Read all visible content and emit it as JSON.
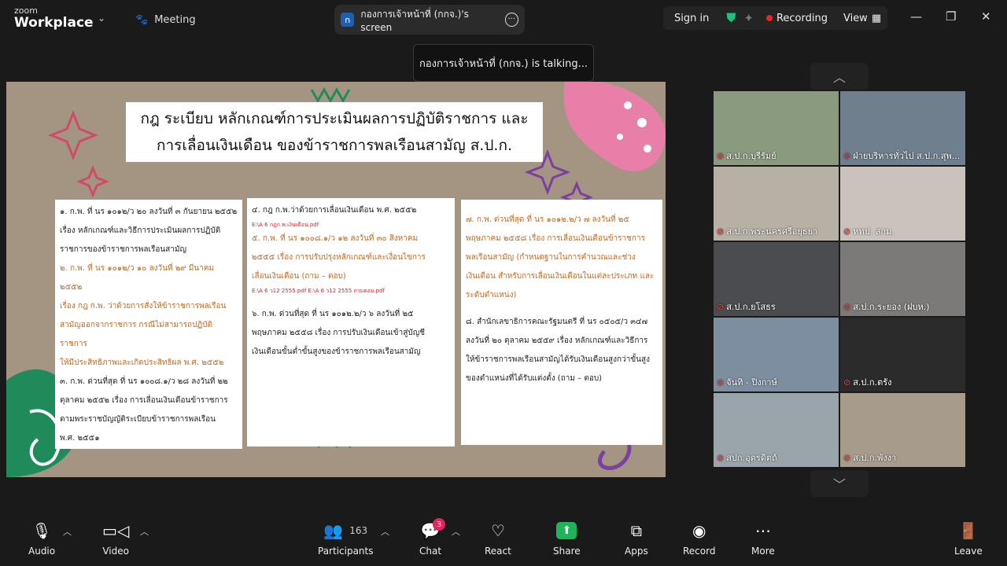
{
  "app": {
    "small": "zoom",
    "name": "Workplace",
    "meeting_tab": "Meeting",
    "screen_tab": "กองการเจ้าหน้าที่ (กกจ.)'s screen",
    "screen_badge": "n"
  },
  "header": {
    "sign_in": "Sign in",
    "recording": "Recording",
    "view": "View"
  },
  "talking": "กองการเจ้าหน้าที่ (กกจ.) is talking...",
  "slide": {
    "title_1": "กฎ ระเบียบ หลักเกณฑ์การประเมินผลการปฏิบัติราชการ และ",
    "title_2": "การเลื่อนเงินเดือน ของข้าราชการพลเรือนสามัญ ส.ป.ก.",
    "col1": [
      "๑. ก.พ. ที่ นร ๑๐๑๒/ว ๒๐ ลงวันที่ ๓ กันยายน ๒๕๕๒",
      "เรื่อง หลักเกณฑ์และวิธีการประเมินผลการปฏิบัติ",
      "ราชการของข้าราชการพลเรือนสามัญ",
      "๒. ก.พ. ที่ นร ๑๐๑๒/ว ๑๐ ลงวันที่ ๒๙ มีนาคม ๒๕๕๒",
      "เรื่อง กฎ ก.พ. ว่าด้วยการสั่งให้ข้าราชการพลเรือน",
      "สามัญออกจากราชการ กรณีไม่สามารถปฏิบัติราชการ",
      "ให้มีประสิทธิภาพและเกิดประสิทธิผล พ.ศ. ๒๕๕๒",
      "๓. ก.พ. ด่วนที่สุด ที่ นร ๑๐๐๘.๑/ว ๒๘ ลงวันที่ ๒๒",
      "ตุลาคม ๒๕๕๒ เรื่อง การเลื่อนเงินเดือนข้าราชการ",
      "ตามพระราชบัญญัติระเบียบข้าราชการพลเรือน",
      "พ.ศ. ๒๕๕๑"
    ],
    "col2": [
      "๔. กฎ ก.พ.ว่าด้วยการเลื่อนเงินเดือน พ.ศ. ๒๕๕๒",
      "E:\\A 6 กฎก.พ.เงินเดือน.pdf",
      "๕. ก.พ. ที่ นร ๑๐๐๘.๑/ว ๑๒ ลงวันที่ ๓๐ สิงหาคม",
      "๒๕๕๕ เรื่อง การปรับปรุงหลักเกณฑ์และเงื่อนไขการ",
      "เลื่อนเงินเดือน (ถาม – ตอบ)",
      "E:\\A 6 ว12 2555.pdf   E:\\A 6 ว12 2555 ถามตอบ.pdf",
      "๖. ก.พ. ด่วนที่สุด ที่ นร ๑๐๑๒.๒/ว ๖ ลงวันที่ ๒๕",
      "พฤษภาคม ๒๕๕๘ เรื่อง การปรับเงินเดือนเข้าสู่บัญชี",
      "เงินเดือนขั้นต่ำขั้นสูงของข้าราชการพลเรือนสามัญ"
    ],
    "col3": [
      "๗. ก.พ. ด่วนที่สุด ที่ นร ๑๐๑๒.๒/ว ๗ ลงวันที่ ๒๕",
      "พฤษภาคม ๒๕๕๘ เรื่อง การเลื่อนเงินเดือนข้าราชการ",
      "พลเรือนสามัญ (กำหนดฐานในการคำนวณและช่วง",
      "เงินเดือน สำหรับการเลื่อนเงินเดือนในแต่ละประเภท และ",
      "ระดับตำแหน่ง)",
      "๘. สำนักเลขาธิการคณะรัฐมนตรี ที่ นร ๐๕๐๕/ว ๓๔๗",
      "ลงวันที่ ๒๐ ตุลาคม ๒๕๕๙ เรื่อง หลักเกณฑ์และวิธีการ",
      "ให้ข้าราชการพลเรือนสามัญได้รับเงินเดือนสูงกว่าขั้นสูง",
      "ของตำแหน่งที่ได้รับแต่งตั้ง (ถาม – ตอบ)"
    ]
  },
  "participants_tiles": [
    {
      "name": "ส.ป.ก.บุรีรัมย์",
      "bg": "#8a9a7e"
    },
    {
      "name": "ฝ่ายบริหารทั่วไป ส.ป.ก.สุพ...",
      "bg": "#6f7f8e"
    },
    {
      "name": "ส.ป.ก.พระนครศรีอยุธยา",
      "bg": "#b7b0a4"
    },
    {
      "name": "หทป. สกม.",
      "bg": "#c9c3bb"
    },
    {
      "name": "ส.ป.ก.ยโสธร",
      "bg": "#4a4c4f"
    },
    {
      "name": "ส.ป.ก.ระยอง (ฝบห.)",
      "bg": "#7c7a78"
    },
    {
      "name": "จันทิ - ปิงกาษ์",
      "bg": "#7d8ea0"
    },
    {
      "name": "ส.ป.ก.ตรัง",
      "bg": "#2b2b2b"
    },
    {
      "name": "สปก.อุตรดิตถ์",
      "bg": "#9aa5ab"
    },
    {
      "name": "ส.ป.ก.พังงา",
      "bg": "#a79c8c"
    }
  ],
  "toolbar": {
    "audio": "Audio",
    "video": "Video",
    "participants": "Participants",
    "participants_count": "163",
    "chat": "Chat",
    "chat_badge": "3",
    "react": "React",
    "share": "Share",
    "apps": "Apps",
    "record": "Record",
    "more": "More",
    "leave": "Leave"
  },
  "colors": {
    "share_green": "#1fb35a",
    "leave_red": "#e0245e",
    "mic_muted": "#ff3b3b",
    "record_dot": "#e02828"
  }
}
